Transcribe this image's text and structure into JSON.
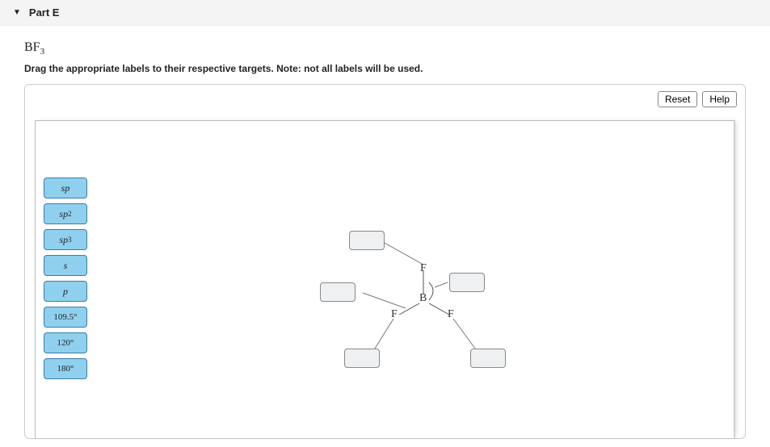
{
  "header": {
    "part_label": "Part E"
  },
  "formula": {
    "base": "BF",
    "sub": "3"
  },
  "instructions": "Drag the appropriate labels to their respective targets. Note: not all labels will be used.",
  "buttons": {
    "reset": "Reset",
    "help": "Help"
  },
  "labels": {
    "l0": "sp",
    "l1_base": "sp",
    "l1_sup": "2",
    "l2_base": "sp",
    "l2_sup": "3",
    "l3": "s",
    "l4": "p",
    "l5_val": "109.5",
    "l5_deg": "°",
    "l6_val": "120",
    "l6_deg": "°",
    "l7_val": "180",
    "l7_deg": "°"
  },
  "atoms": {
    "B": "B",
    "F_top": "F",
    "F_left": "F",
    "F_right": "F"
  }
}
